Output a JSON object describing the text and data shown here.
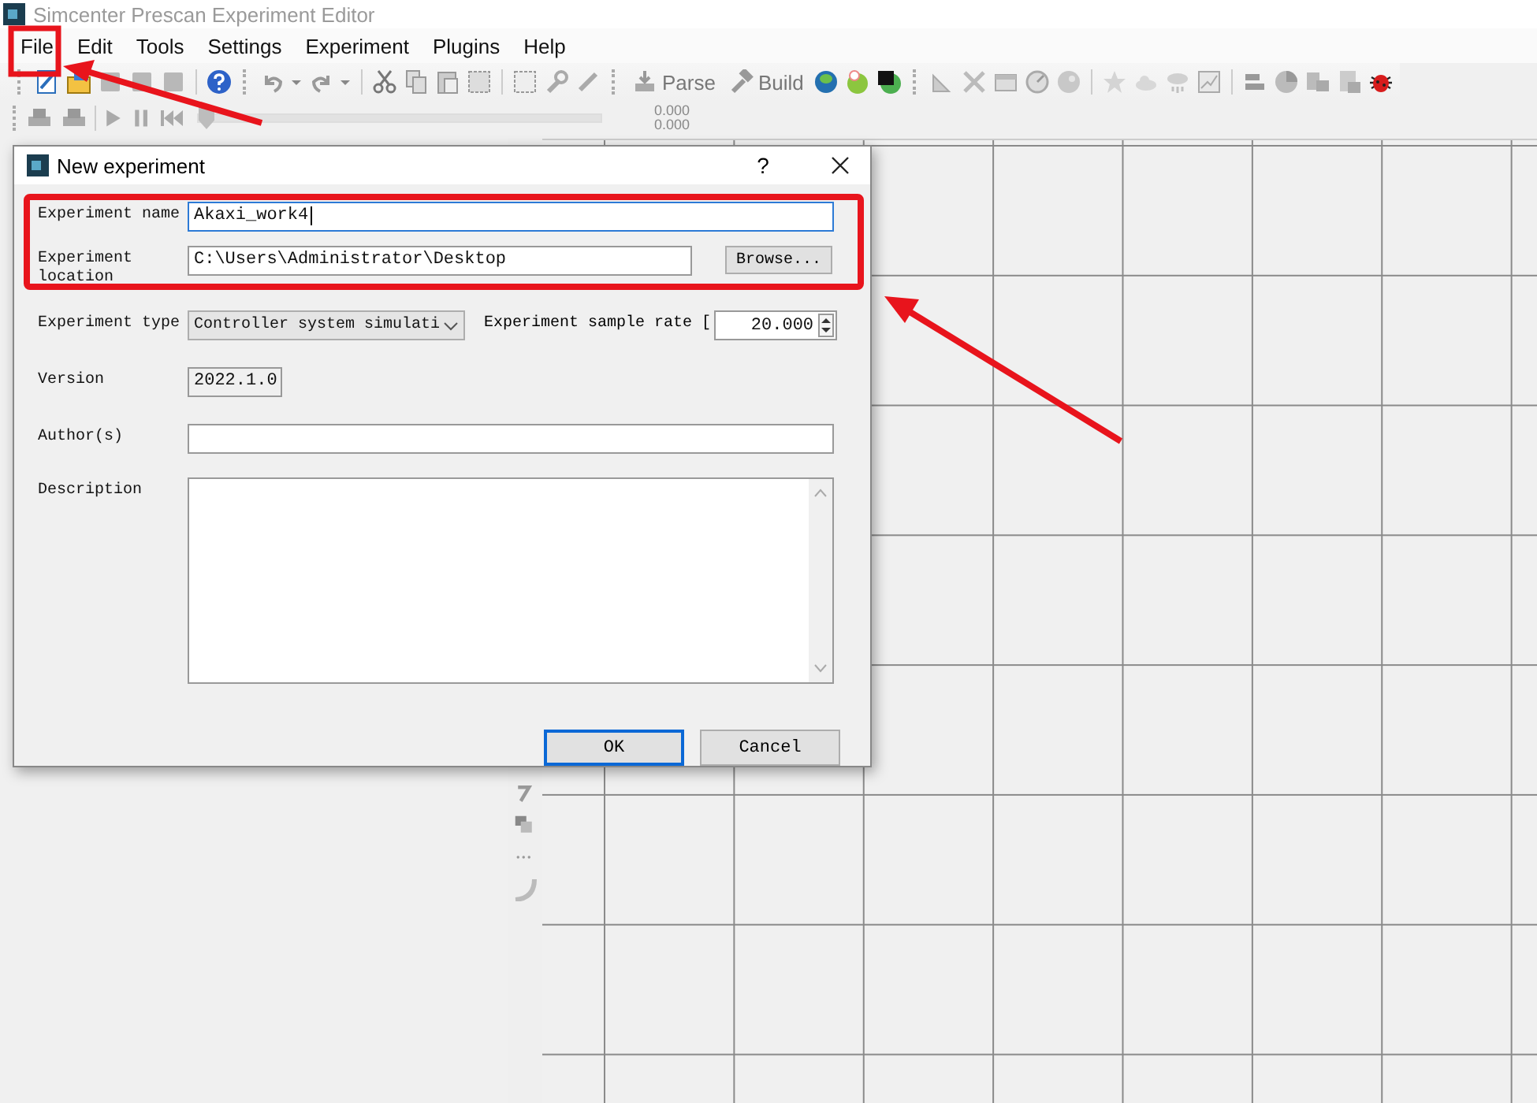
{
  "window": {
    "title": "Simcenter Prescan Experiment Editor"
  },
  "menu": [
    "File",
    "Edit",
    "Tools",
    "Settings",
    "Experiment",
    "Plugins",
    "Help"
  ],
  "toolbar": {
    "parse": "Parse",
    "build": "Build"
  },
  "playback": {
    "slider": {
      "level": 0
    },
    "readings": [
      "0.000",
      "0.000"
    ]
  },
  "dialog": {
    "title": "New experiment",
    "help": "?",
    "fields": [
      {
        "kind": "text",
        "label": "Experiment name",
        "value": "Akaxi_work4",
        "focused": true
      },
      {
        "kind": "path",
        "label": "Experiment location",
        "value": "C:\\Users\\Administrator\\Desktop",
        "button": "Browse...",
        "focused": false
      },
      {
        "kind": "combo",
        "label": "Experiment type",
        "value": "Controller system simulati",
        "side_label": "Experiment sample rate [",
        "side_value": "20.000",
        "focused": false
      },
      {
        "kind": "readonly",
        "label": "Version",
        "value": "2022.1.0",
        "focused": false
      },
      {
        "kind": "text",
        "label": "Author(s)",
        "focused": false
      },
      {
        "kind": "textarea",
        "label": "Description",
        "focused": false
      }
    ],
    "buttons": [
      {
        "label": "OK",
        "default": true
      },
      {
        "label": "Cancel",
        "default": false
      }
    ]
  }
}
